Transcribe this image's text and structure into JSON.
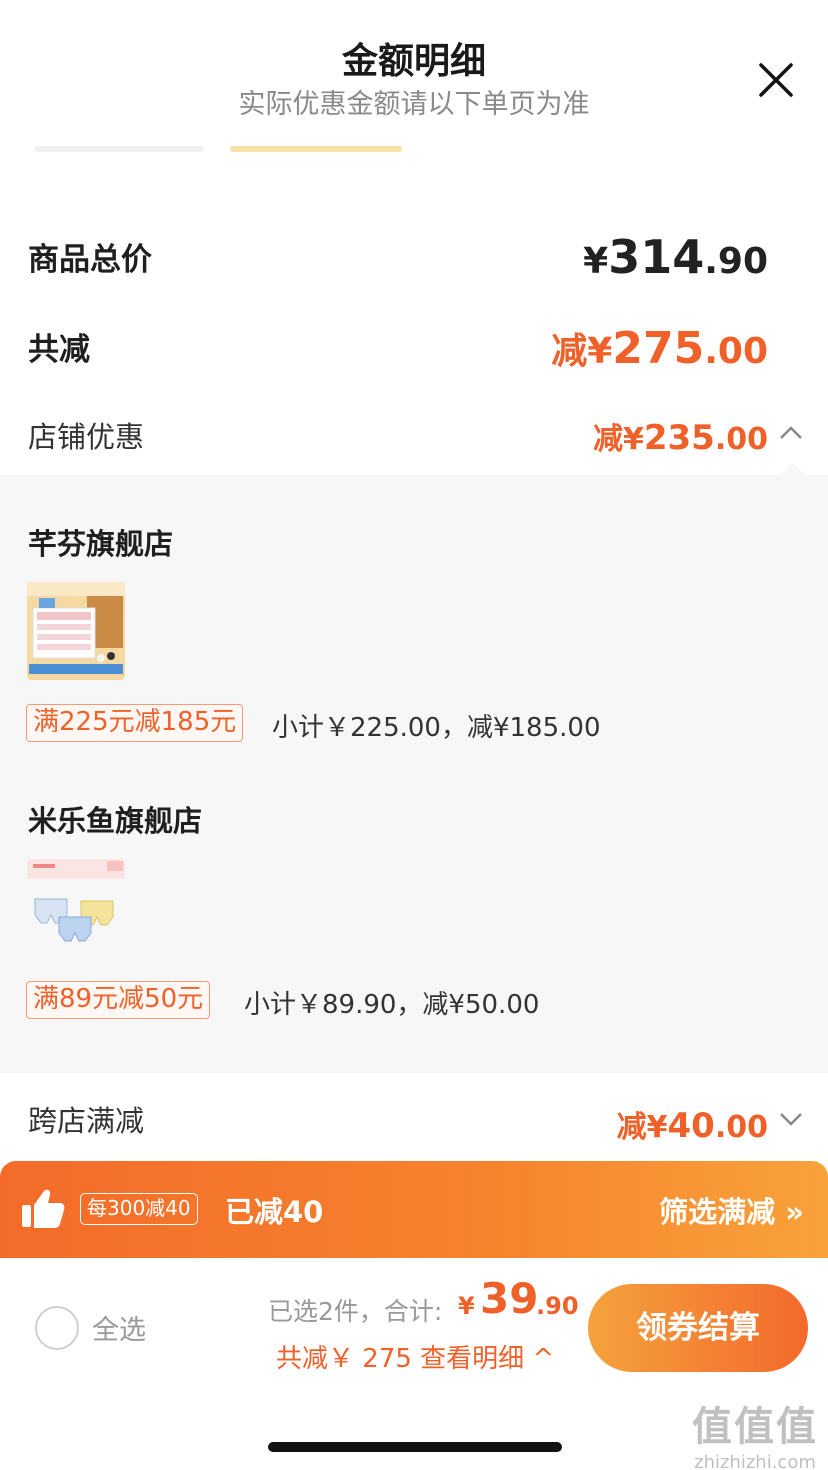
{
  "header": {
    "title": "金额明细",
    "subtitle": "实际优惠金额请以下单页为准",
    "close_icon": "close-icon"
  },
  "summary": {
    "total_label": "商品总价",
    "total_symbol": "¥",
    "total_int": "314",
    "total_dec": ".90",
    "discount_label": "共减",
    "discount_prefix": "减",
    "discount_symbol": "¥",
    "discount_int": "275",
    "discount_dec": ".00"
  },
  "shop_discount": {
    "label": "店铺优惠",
    "prefix": "减",
    "symbol": "¥",
    "int": "235",
    "dec": ".00",
    "icon": "chevron-up-icon",
    "expanded": true
  },
  "stores": [
    {
      "name": "芊芬旗舰店",
      "promo": "满225元减185元",
      "subtotal": "小计￥225.00，减¥185.00"
    },
    {
      "name": "米乐鱼旗舰店",
      "promo": "满89元减50元",
      "subtotal": "小计￥89.90，减¥50.00"
    }
  ],
  "cross_store": {
    "label": "跨店满减",
    "prefix": "减",
    "symbol": "¥",
    "int": "40",
    "dec": ".00",
    "icon": "chevron-down-icon"
  },
  "banner": {
    "icon": "thumbs-up-icon",
    "rule": "每300减40",
    "status": "已减40",
    "filter": "筛选满减 »"
  },
  "bottom": {
    "select_all": "全选",
    "selected": "已选2件，合计:",
    "sum_symbol": "¥",
    "sum_int": "39",
    "sum_dec": ".90",
    "total_saved": "共减￥ 275 查看明细 ^",
    "checkout": "领券结算"
  },
  "watermark": {
    "big": "值值值",
    "small": "zhizhizhi.com"
  },
  "colors": {
    "accent": "#f0612a",
    "banner_start": "#f36b2a",
    "banner_end": "#f9a23b",
    "tag_border": "#f59a72"
  }
}
